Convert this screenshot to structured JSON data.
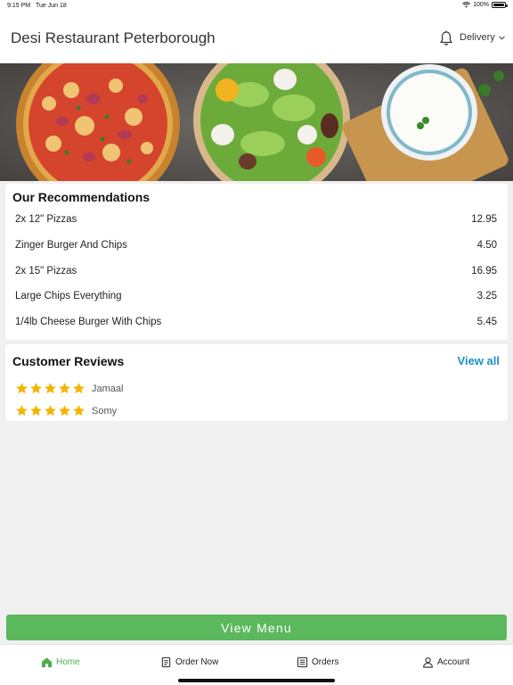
{
  "status_bar": {
    "time": "9:15 PM",
    "date": "Tue Jun 18",
    "battery": "100%",
    "battery_level": 1.0
  },
  "header": {
    "title": "Desi Restaurant Peterborough",
    "mode_label": "Delivery"
  },
  "recommendations": {
    "title": "Our Recommendations",
    "items": [
      {
        "name": "2x 12\" Pizzas",
        "price": "12.95"
      },
      {
        "name": "Zinger Burger And Chips",
        "price": "4.50"
      },
      {
        "name": "2x 15\" Pizzas",
        "price": "16.95"
      },
      {
        "name": "Large Chips Everything",
        "price": "3.25"
      },
      {
        "name": "1/4lb Cheese Burger With Chips",
        "price": "5.45"
      }
    ]
  },
  "reviews": {
    "title": "Customer Reviews",
    "view_all": "View all",
    "items": [
      {
        "name": "Jamaal",
        "rating": 5
      },
      {
        "name": "Somy",
        "rating": 5
      }
    ]
  },
  "view_menu_label": "View Menu",
  "tabs": [
    {
      "label": "Home",
      "icon": "home-icon",
      "active": true
    },
    {
      "label": "Order Now",
      "icon": "order-list-icon",
      "active": false
    },
    {
      "label": "Orders",
      "icon": "orders-icon",
      "active": false
    },
    {
      "label": "Account",
      "icon": "user-icon",
      "active": false
    }
  ],
  "colors": {
    "accent": "#5cb85c",
    "link": "#1e8fc6",
    "star": "#f5b400"
  }
}
